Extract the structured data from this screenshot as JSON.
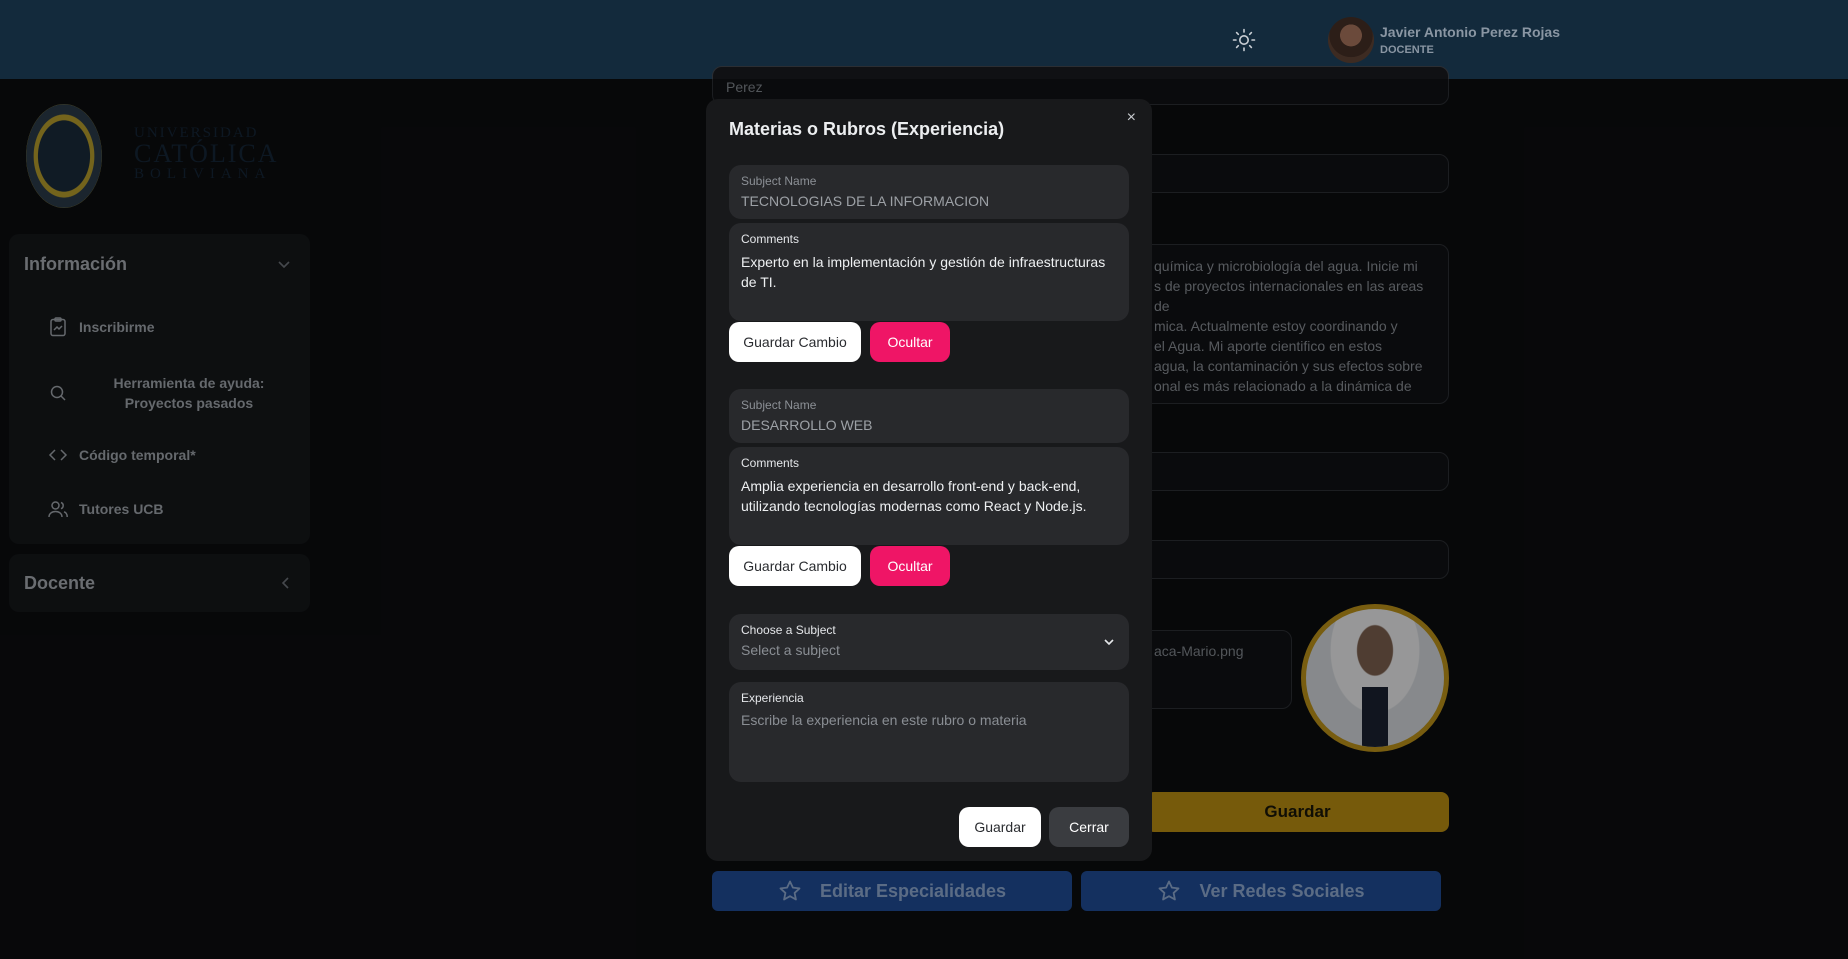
{
  "header": {
    "user_name": "Javier Antonio Perez Rojas",
    "user_role": "DOCENTE"
  },
  "logo": {
    "line1": "UNIVERSIDAD",
    "line2": "CATÓLICA",
    "line3": "BOLIVIANA"
  },
  "sidebar": {
    "info_header": "Información",
    "items": [
      {
        "label": "Inscribirme",
        "icon": "clipboard-icon"
      },
      {
        "label": "Herramienta de ayuda: Proyectos pasados",
        "icon": "search-icon"
      },
      {
        "label": "Código temporal*",
        "icon": "code-icon"
      },
      {
        "label": "Tutores UCB",
        "icon": "users-icon"
      }
    ],
    "item2_line1": "Herramienta de ayuda:",
    "item2_line2": "Proyectos pasados",
    "docente_header": "Docente"
  },
  "background_form": {
    "last_name_value": "Perez",
    "bio_lines": [
      "química y microbiología del agua. Inicie mi",
      "s de proyectos internacionales en las areas de",
      "mica. Actualmente estoy coordinando y",
      "el Agua. Mi aporte cientifico en estos",
      "agua, la contaminación y sus efectos sobre",
      "onal es más relacionado a la dinámica de"
    ],
    "file_name": "aca-Mario.png",
    "save_button": "Guardar",
    "edit_specialties_button": "Editar Especialidades",
    "social_button": "Ver Redes Sociales"
  },
  "modal": {
    "title": "Materias o Rubros (Experiencia)",
    "close": "×",
    "entries": [
      {
        "subject_label": "Subject Name",
        "subject_value": "TECNOLOGIAS DE LA INFORMACION",
        "comments_label": "Comments",
        "comments_value": "Experto en la implementación y gestión de infraestructuras de TI.",
        "save_label": "Guardar Cambio",
        "hide_label": "Ocultar"
      },
      {
        "subject_label": "Subject Name",
        "subject_value": "DESARROLLO WEB",
        "comments_label": "Comments",
        "comments_value": "Amplia experiencia en desarrollo front-end y back-end, utilizando tecnologías modernas como React y Node.js.",
        "save_label": "Guardar Cambio",
        "hide_label": "Ocultar"
      }
    ],
    "choose_label": "Choose a Subject",
    "choose_placeholder": "Select a subject",
    "experience_label": "Experiencia",
    "experience_placeholder": "Escribe la experiencia en este rubro o materia",
    "save_button": "Guardar",
    "close_button": "Cerrar"
  }
}
